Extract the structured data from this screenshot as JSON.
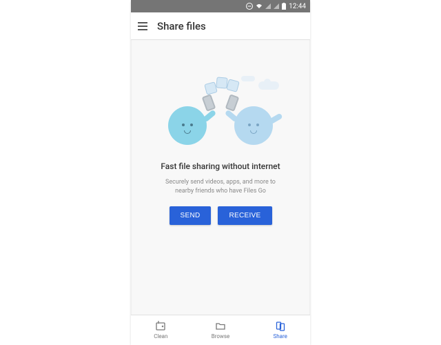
{
  "status": {
    "time": "12:44"
  },
  "appbar": {
    "title": "Share files"
  },
  "main": {
    "heading": "Fast file sharing without internet",
    "subtext": "Securely send videos, apps, and more to nearby friends who have Files Go",
    "send_label": "SEND",
    "receive_label": "RECEIVE"
  },
  "nav": {
    "items": [
      {
        "label": "Clean"
      },
      {
        "label": "Browse"
      },
      {
        "label": "Share"
      }
    ]
  }
}
